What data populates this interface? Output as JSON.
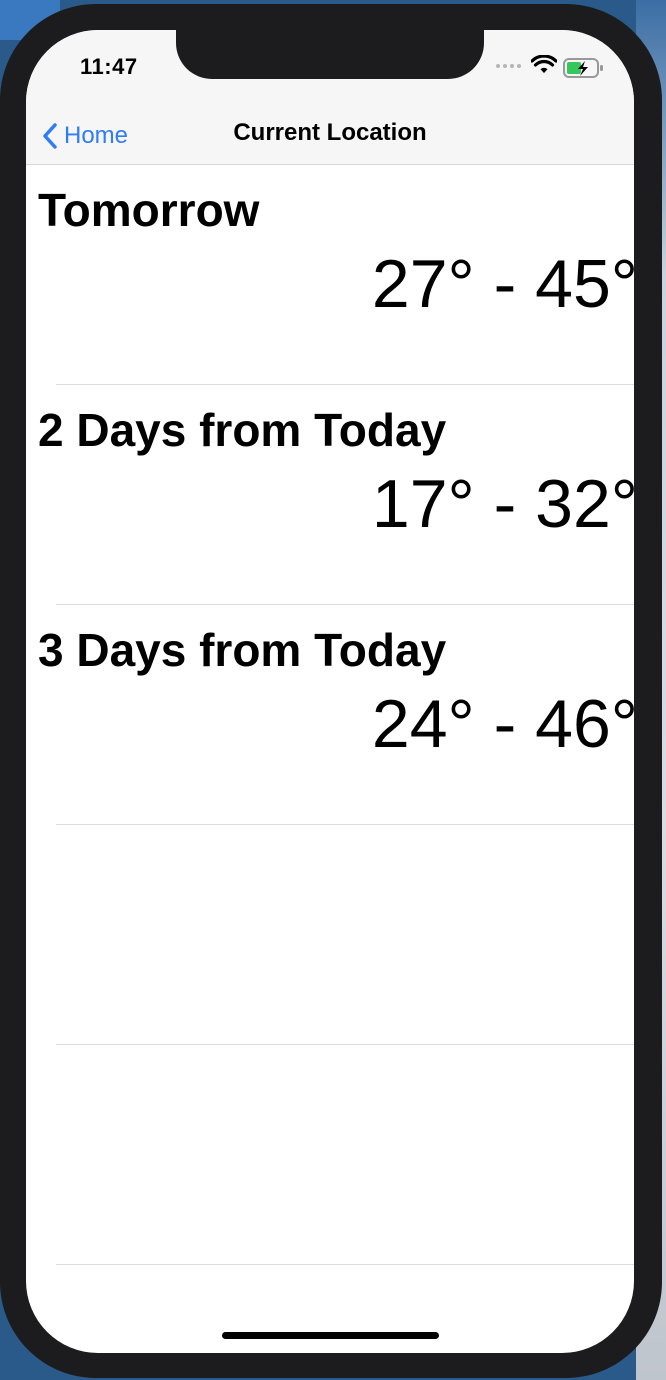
{
  "status_bar": {
    "time": "11:47",
    "icons": [
      "signal-dots-icon",
      "wifi-icon",
      "battery-charging-icon"
    ]
  },
  "nav": {
    "back_label": "Home",
    "title": "Current Location",
    "accent_color": "#2f7cf6"
  },
  "forecast": [
    {
      "day": "Tomorrow",
      "range": "27° - 45°"
    },
    {
      "day": "2 Days from Today",
      "range": "17° - 32°"
    },
    {
      "day": "3 Days from Today",
      "range": "24° - 46°"
    },
    {
      "day": "",
      "range": ""
    },
    {
      "day": "",
      "range": ""
    }
  ]
}
